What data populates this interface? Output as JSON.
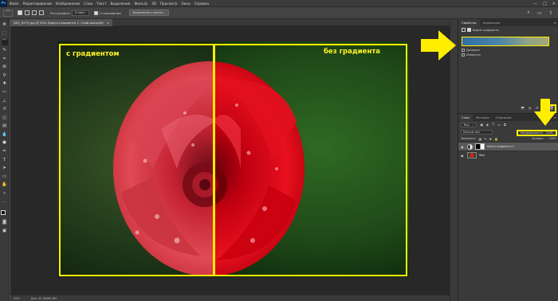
{
  "app": {
    "logo": "Ps",
    "menu": [
      "Файл",
      "Редактирование",
      "Изображение",
      "Слои",
      "Текст",
      "Выделение",
      "Фильтр",
      "3D",
      "Просмотр",
      "Окно",
      "Справка"
    ],
    "window_controls": [
      "—",
      "□",
      "✕"
    ]
  },
  "options": {
    "feather_label": "Растушевка:",
    "feather_value": "0 пикс.",
    "antialias_label": "Сглаживание",
    "select_mask_button": "Выделение и маска..."
  },
  "document": {
    "tab_title": "DSC_9279.jpg @ 25% (Карта градиента 1, Слой-маска/8)",
    "tab_close": "×",
    "zoom": "25%",
    "doc_size": "Док: 42,9M/85,8M"
  },
  "canvas": {
    "caption_left": "с градиентом",
    "caption_right": "без градиента"
  },
  "properties": {
    "tabs": [
      "Свойства",
      "Коррекция"
    ],
    "menu_icon": "≡",
    "header_label": "Карта градиента",
    "gradient_colors": [
      "#2f6fa6",
      "#a6a876"
    ],
    "dither_label": "Дизеринг",
    "reverse_label": "Инверсия",
    "footer_icons": [
      "clip-icon",
      "view-previous-icon",
      "reset-icon",
      "visibility-icon",
      "trash-icon"
    ]
  },
  "layers": {
    "tabs": [
      "Слои",
      "История",
      "Операции"
    ],
    "menu_icon": "≡",
    "kind_label": "Вид",
    "blend_mode": "Мягкий свет",
    "opacity_label": "Непрозрачность:",
    "opacity_value": "100%",
    "lock_label": "Закрепить:",
    "fill_label": "Заливка:",
    "fill_value": "100%",
    "items": [
      {
        "name": "Карта градиента 1",
        "selected": true
      },
      {
        "name": "Фон",
        "selected": false
      }
    ]
  },
  "colors": {
    "highlight": "#ffee00",
    "panel_bg": "#3a3a3a",
    "workspace_bg": "#282828"
  }
}
